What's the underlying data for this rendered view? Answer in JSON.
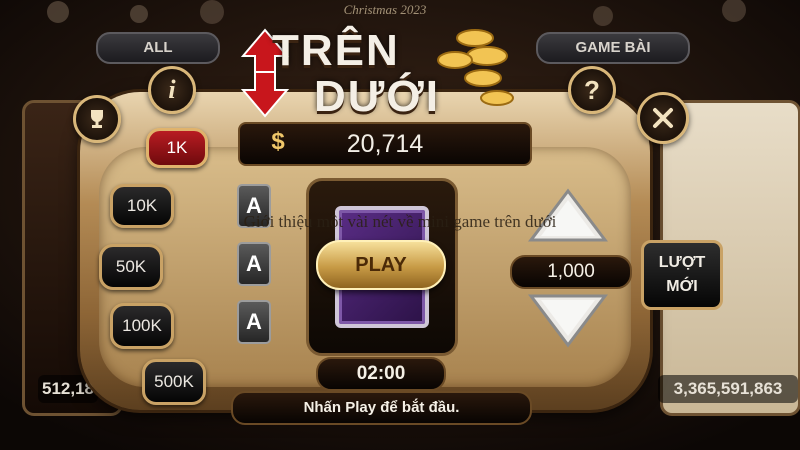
{
  "tabs": {
    "all_label": "ALL",
    "game_bai_label": "GAME BÀI"
  },
  "header": {
    "banner_text": "Christmas 2023"
  },
  "side_panels": {
    "left_value": "512,18",
    "right_value": "3,365,591,863"
  },
  "title": {
    "line1": "TRÊN",
    "line2": "DƯỚI"
  },
  "balance": {
    "currency_symbol": "$",
    "amount": "20,714"
  },
  "chips": {
    "c1": "1K",
    "c2": "10K",
    "c3": "50K",
    "c4": "100K",
    "c5": "500K"
  },
  "cards": {
    "a1": "A",
    "a2": "A",
    "a3": "A"
  },
  "center": {
    "play_label": "PLAY",
    "timer": "02:00"
  },
  "bet": {
    "amount": "1,000"
  },
  "new_round": {
    "line1": "LƯỢT",
    "line2": "MỚI"
  },
  "buttons": {
    "info_label": "i",
    "help_label": "?"
  },
  "status": {
    "message": "Nhấn Play để bắt đầu."
  },
  "caption": {
    "text": "Giới thiệu một vài nét về mini game trên dưới"
  },
  "colors": {
    "accent_gold": "#d9b77a",
    "active_chip": "#b81c22",
    "frame_gold": "#b48b55"
  }
}
